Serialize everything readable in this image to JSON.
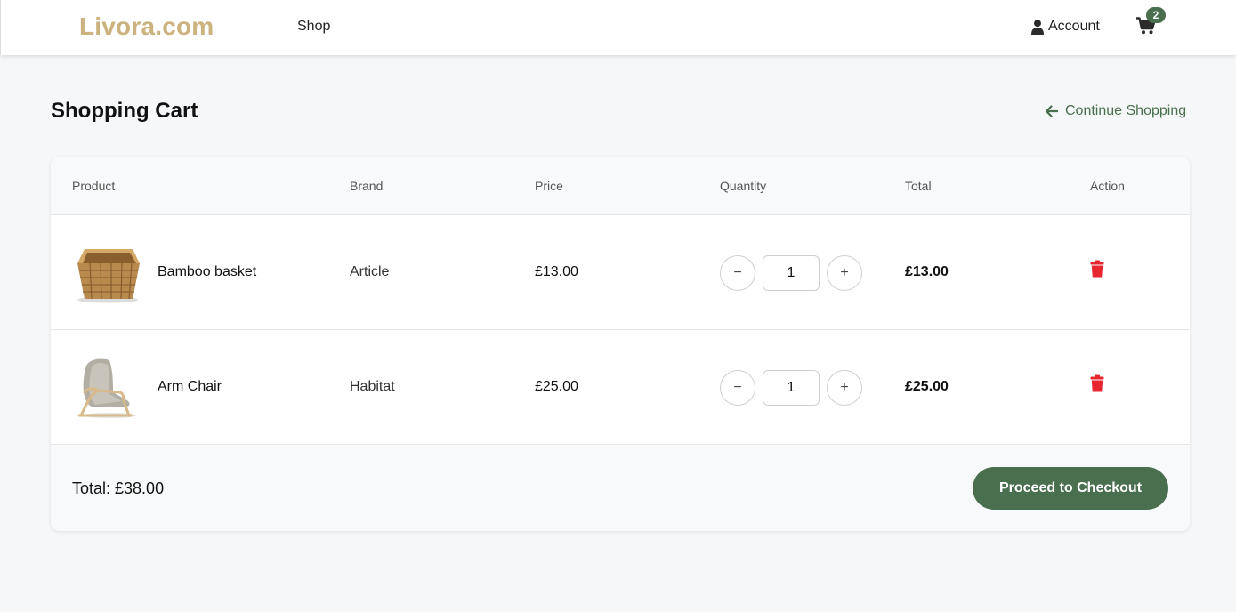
{
  "header": {
    "logo": "Livora.com",
    "nav_shop": "Shop",
    "account_label": "Account",
    "account_icon": "user-icon",
    "cart_icon": "cart-icon",
    "cart_count": "2"
  },
  "page": {
    "title": "Shopping Cart",
    "continue_label": "Continue Shopping",
    "continue_icon": "arrow-left-icon"
  },
  "table": {
    "columns": [
      "Product",
      "Brand",
      "Price",
      "Quantity",
      "Total",
      "Action"
    ],
    "rows": [
      {
        "image": "bamboo-basket-image",
        "name": "Bamboo basket",
        "brand": "Article",
        "price": "£13.00",
        "quantity": "1",
        "total": "£13.00"
      },
      {
        "image": "arm-chair-image",
        "name": "Arm Chair",
        "brand": "Habitat",
        "price": "£25.00",
        "quantity": "1",
        "total": "£25.00"
      }
    ],
    "decrement_label": "−",
    "increment_label": "+",
    "delete_icon": "trash-icon"
  },
  "footer": {
    "total_label": "Total: £38.00",
    "checkout_label": "Proceed to Checkout"
  },
  "colors": {
    "accent": "#4a6f4e",
    "logo": "#cbb27e",
    "delete": "#e8262f",
    "background": "#f6f7f9"
  }
}
